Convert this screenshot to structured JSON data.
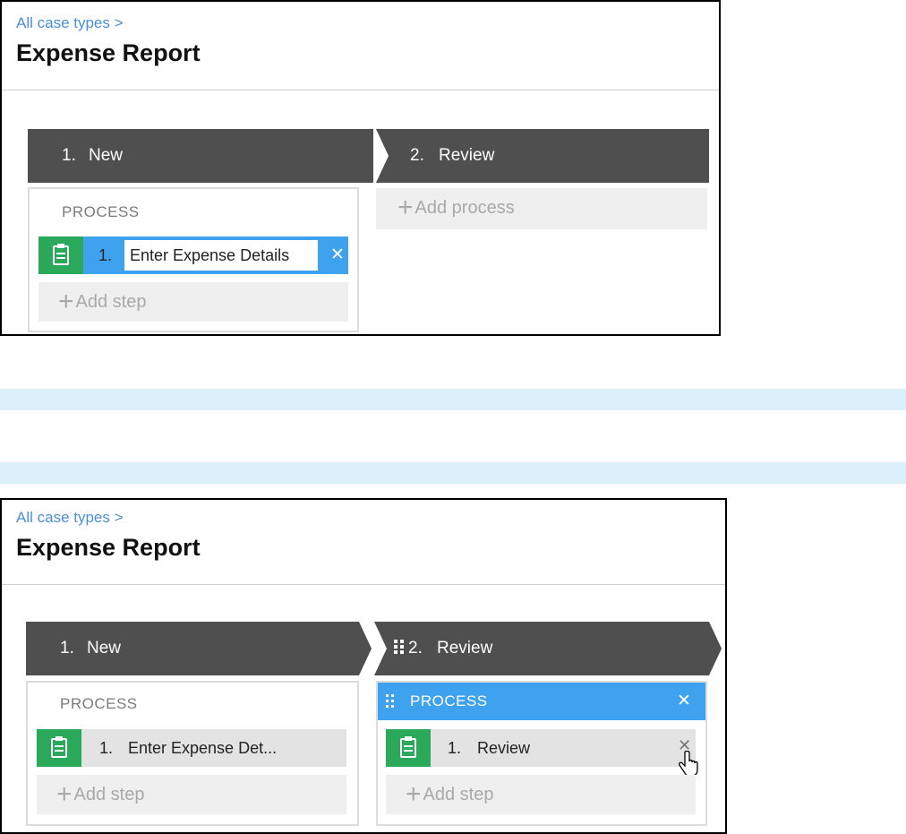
{
  "top": {
    "breadcrumb": "All case types >",
    "title": "Expense Report",
    "stages": [
      {
        "number": "1.",
        "name": "New"
      },
      {
        "number": "2.",
        "name": "Review"
      }
    ],
    "process_label": "PROCESS",
    "step": {
      "number": "1.",
      "name": "Enter Expense Details"
    },
    "add_step": "Add step",
    "add_process": "Add process"
  },
  "bottom": {
    "breadcrumb": "All case types >",
    "title": "Expense Report",
    "stages": [
      {
        "number": "1.",
        "name": "New"
      },
      {
        "number": "2.",
        "name": "Review"
      }
    ],
    "process_label": "PROCESS",
    "step1": {
      "number": "1.",
      "name": "Enter Expense Det..."
    },
    "add_step": "Add step",
    "process2_label": "PROCESS",
    "step2": {
      "number": "1.",
      "name": "Review"
    },
    "add_step2": "Add step"
  },
  "colors": {
    "stage": "#4f4f4f",
    "accent_blue": "#3ea2ee",
    "step_green": "#2aa95a",
    "link": "#4a8fd8",
    "divider_bar": "#dcf0fb"
  }
}
